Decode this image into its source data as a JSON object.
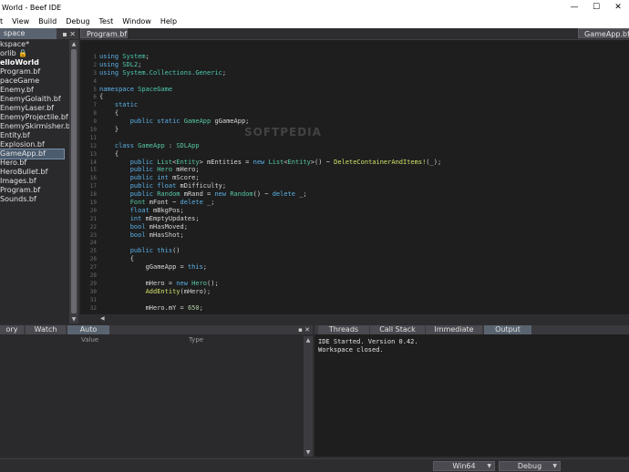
{
  "window": {
    "title": "World - Beef IDE",
    "minimize": "—",
    "maximize": "☐",
    "close": "✕"
  },
  "menu": [
    "t",
    "View",
    "Build",
    "Debug",
    "Test",
    "Window",
    "Help"
  ],
  "workspace": {
    "tab_label": "space",
    "tools": "▪ ✕",
    "tree": [
      {
        "label": "kspace*",
        "bold": false,
        "selected": false
      },
      {
        "label": "orlib 🔒",
        "bold": false,
        "selected": false
      },
      {
        "label": "elloWorld",
        "bold": true,
        "selected": false
      },
      {
        "label": "Program.bf",
        "bold": false,
        "selected": false
      },
      {
        "label": "paceGame",
        "bold": false,
        "selected": false
      },
      {
        "label": "Enemy.bf",
        "bold": false,
        "selected": false
      },
      {
        "label": "EnemyGolaith.bf",
        "bold": false,
        "selected": false
      },
      {
        "label": "EnemyLaser.bf",
        "bold": false,
        "selected": false
      },
      {
        "label": "EnemyProjectile.bf",
        "bold": false,
        "selected": false
      },
      {
        "label": "EnemySkirmisher.bf",
        "bold": false,
        "selected": false
      },
      {
        "label": "Entity.bf",
        "bold": false,
        "selected": false
      },
      {
        "label": "Explosion.bf",
        "bold": false,
        "selected": false
      },
      {
        "label": "GameApp.bf",
        "bold": false,
        "selected": true
      },
      {
        "label": "Hero.bf",
        "bold": false,
        "selected": false
      },
      {
        "label": "HeroBullet.bf",
        "bold": false,
        "selected": false
      },
      {
        "label": "Images.bf",
        "bold": false,
        "selected": false
      },
      {
        "label": "Program.bf",
        "bold": false,
        "selected": false
      },
      {
        "label": "Sounds.bf",
        "bold": false,
        "selected": false
      }
    ]
  },
  "editor": {
    "tab_left": "Program.bf",
    "tab_right": "GameApp.bf",
    "watermark": "SOFTPEDIA",
    "lines": [
      [
        [
          "kw",
          "using "
        ],
        [
          "ns",
          "System"
        ],
        [
          "op",
          ";"
        ]
      ],
      [
        [
          "kw",
          "using "
        ],
        [
          "ns",
          "SDL2"
        ],
        [
          "op",
          ";"
        ]
      ],
      [
        [
          "kw",
          "using "
        ],
        [
          "ns",
          "System.Collections.Generic"
        ],
        [
          "op",
          ";"
        ]
      ],
      [],
      [
        [
          "kw",
          "namespace "
        ],
        [
          "ns",
          "SpaceGame"
        ]
      ],
      [
        [
          "op",
          "{"
        ]
      ],
      [
        [
          "kw",
          "    static"
        ]
      ],
      [
        [
          "op",
          "    {"
        ]
      ],
      [
        [
          "kw",
          "        public static "
        ],
        [
          "ty",
          "GameApp "
        ],
        [
          "ident",
          "gGameApp;"
        ]
      ],
      [
        [
          "op",
          "    }"
        ]
      ],
      [],
      [
        [
          "kw",
          "    class "
        ],
        [
          "ty",
          "GameApp "
        ],
        [
          "op",
          ": "
        ],
        [
          "ty",
          "SDLApp"
        ]
      ],
      [
        [
          "op",
          "    {"
        ]
      ],
      [
        [
          "kw",
          "        public "
        ],
        [
          "ty",
          "List"
        ],
        [
          "op",
          "<"
        ],
        [
          "ty",
          "Entity"
        ],
        [
          "op",
          "> "
        ],
        [
          "ident",
          "mEntities = "
        ],
        [
          "kw",
          "new "
        ],
        [
          "ty",
          "List"
        ],
        [
          "op",
          "<"
        ],
        [
          "ty",
          "Entity"
        ],
        [
          "op",
          ">() ~ "
        ],
        [
          "fn",
          "DeleteContainerAndItems!"
        ],
        [
          "op",
          "(_);"
        ]
      ],
      [
        [
          "kw",
          "        public "
        ],
        [
          "ty",
          "Hero "
        ],
        [
          "ident",
          "mHero;"
        ]
      ],
      [
        [
          "kw",
          "        public int "
        ],
        [
          "ident",
          "mScore;"
        ]
      ],
      [
        [
          "kw",
          "        public float "
        ],
        [
          "ident",
          "mDifficulty;"
        ]
      ],
      [
        [
          "kw",
          "        public "
        ],
        [
          "ty",
          "Random "
        ],
        [
          "ident",
          "mRand = "
        ],
        [
          "kw",
          "new "
        ],
        [
          "ty",
          "Random"
        ],
        [
          "op",
          "() ~ "
        ],
        [
          "kw",
          "delete "
        ],
        [
          "op",
          "_;"
        ]
      ],
      [
        [
          "ty",
          "        Font "
        ],
        [
          "ident",
          "mFont ~ "
        ],
        [
          "kw",
          "delete "
        ],
        [
          "op",
          "_;"
        ]
      ],
      [
        [
          "kw",
          "        float "
        ],
        [
          "ident",
          "mBkgPos;"
        ]
      ],
      [
        [
          "kw",
          "        int "
        ],
        [
          "ident",
          "mEmptyUpdates;"
        ]
      ],
      [
        [
          "kw",
          "        bool "
        ],
        [
          "ident",
          "mHasMoved;"
        ]
      ],
      [
        [
          "kw",
          "        bool "
        ],
        [
          "ident",
          "mHasShot;"
        ]
      ],
      [],
      [
        [
          "kw",
          "        public this"
        ],
        [
          "op",
          "()"
        ]
      ],
      [
        [
          "op",
          "        {"
        ]
      ],
      [
        [
          "ident",
          "            gGameApp = "
        ],
        [
          "kw",
          "this"
        ],
        [
          "op",
          ";"
        ]
      ],
      [],
      [
        [
          "ident",
          "            mHero = "
        ],
        [
          "kw",
          "new "
        ],
        [
          "ty",
          "Hero"
        ],
        [
          "op",
          "();"
        ]
      ],
      [
        [
          "fn",
          "            AddEntity"
        ],
        [
          "op",
          "(mHero);"
        ]
      ],
      [],
      [
        [
          "ident",
          "            mHero.mY = "
        ],
        [
          "num",
          "650"
        ],
        [
          "op",
          ";"
        ]
      ]
    ]
  },
  "bottom_left": {
    "tabs": [
      "ory",
      "Watch",
      "Auto"
    ],
    "active": "Auto",
    "tools": "▪ ✕",
    "columns": [
      "Value",
      "Type"
    ]
  },
  "bottom_right": {
    "tabs": [
      "Threads",
      "Call Stack",
      "Immediate",
      "Output"
    ],
    "active": "Output",
    "output_lines": [
      "IDE Started. Version 0.42.",
      "Workspace closed."
    ]
  },
  "status": {
    "platform": "Win64",
    "config": "Debug"
  }
}
